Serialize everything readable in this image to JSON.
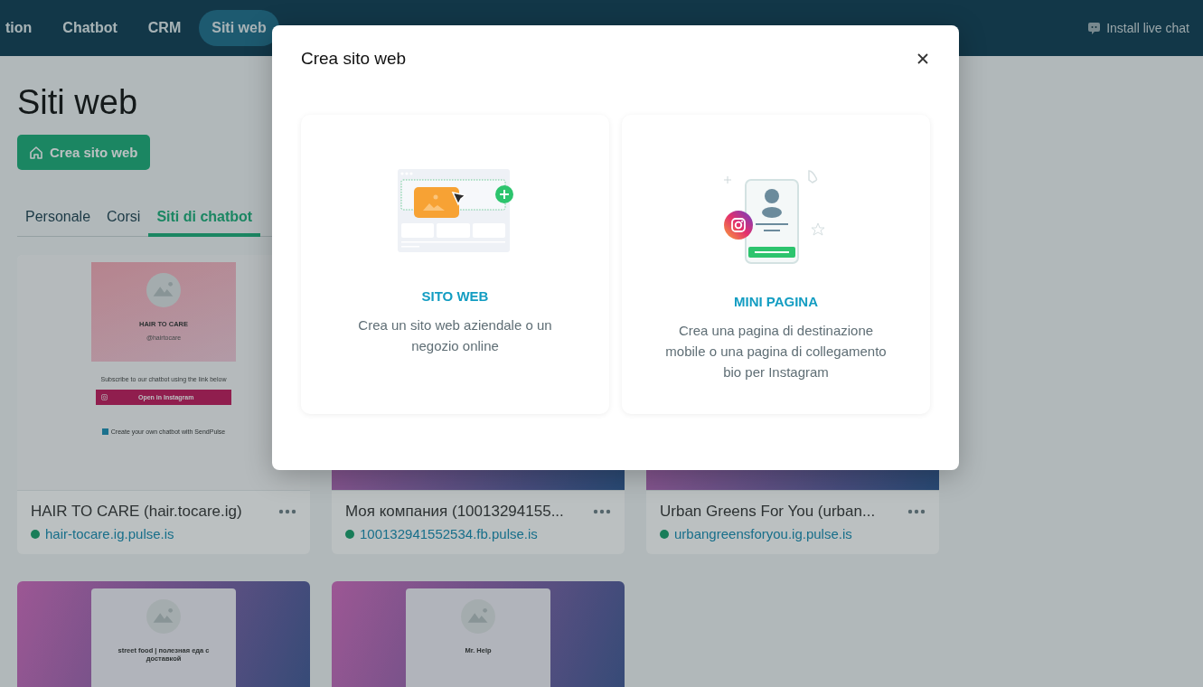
{
  "nav": {
    "items": [
      {
        "label": "tion",
        "selected": false
      },
      {
        "label": "Chatbot",
        "selected": false
      },
      {
        "label": "CRM",
        "selected": false
      },
      {
        "label": "Siti web",
        "selected": true
      }
    ],
    "live_chat": "Install live chat"
  },
  "page": {
    "title": "Siti web",
    "create_button": "Crea sito web"
  },
  "tabs": [
    {
      "label": "Personale",
      "selected": false
    },
    {
      "label": "Corsi",
      "selected": false
    },
    {
      "label": "Siti di chatbot",
      "selected": true
    }
  ],
  "sites": [
    {
      "title": "HAIR TO CARE (hair.tocare.ig)",
      "url": "hair-tocare.ig.pulse.is",
      "preview": {
        "kind": "light",
        "name": "HAIR TO CARE",
        "handle": "@hairtocare",
        "text": "Subscribe to our chatbot using the link below",
        "button": "Open in Instagram",
        "footer": "Create your own chatbot with SendPulse"
      }
    },
    {
      "title": "Моя компания (10013294155...",
      "url": "100132941552534.fb.pulse.is",
      "preview": {
        "kind": "gradient"
      }
    },
    {
      "title": "Urban Greens For You (urban...",
      "url": "urbangreensforyou.ig.pulse.is",
      "preview": {
        "kind": "gradient"
      }
    },
    {
      "preview": {
        "kind": "gradient",
        "name": "street food | полезная еда с доставкой"
      }
    },
    {
      "preview": {
        "kind": "gradient",
        "name": "Mr. Help"
      }
    }
  ],
  "modal": {
    "title": "Crea sito web",
    "options": [
      {
        "kind": "website",
        "title": "SITO WEB",
        "description": "Crea un sito web aziendale o un negozio online"
      },
      {
        "kind": "mini",
        "title": "MINI PAGINA",
        "description": "Crea una pagina di destinazione mobile o una pagina di collegamento bio per Instagram"
      }
    ]
  }
}
